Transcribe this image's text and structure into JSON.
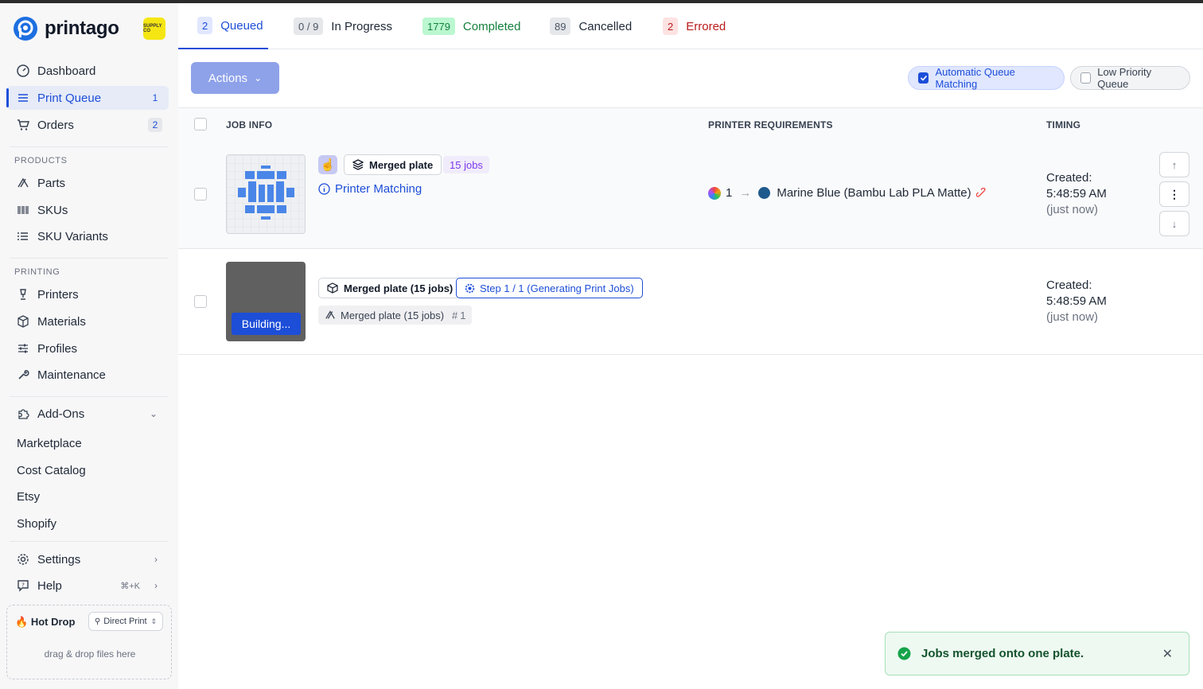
{
  "brand": {
    "name": "printago",
    "badge_text": "SUPPLY CO"
  },
  "nav": {
    "dashboard": "Dashboard",
    "print_queue": "Print Queue",
    "print_queue_count": "1",
    "orders": "Orders",
    "orders_count": "2",
    "products_label": "PRODUCTS",
    "parts": "Parts",
    "skus": "SKUs",
    "sku_variants": "SKU Variants",
    "printing_label": "PRINTING",
    "printers": "Printers",
    "materials": "Materials",
    "profiles": "Profiles",
    "maintenance": "Maintenance",
    "addons": "Add-Ons",
    "marketplace": "Marketplace",
    "cost_catalog": "Cost Catalog",
    "etsy": "Etsy",
    "shopify": "Shopify",
    "settings": "Settings",
    "help": "Help",
    "help_shortcut": "⌘+K"
  },
  "hotdrop": {
    "title": "Hot Drop",
    "select_value": "Direct Print",
    "hint": "drag & drop files here"
  },
  "tabs": [
    {
      "count": "2",
      "label": "Queued"
    },
    {
      "count": "0 / 9",
      "label": "In Progress"
    },
    {
      "count": "1779",
      "label": "Completed"
    },
    {
      "count": "89",
      "label": "Cancelled"
    },
    {
      "count": "2",
      "label": "Errored"
    }
  ],
  "toolbar": {
    "actions_label": "Actions",
    "auto_match_label": "Automatic Queue Matching",
    "auto_match_checked": true,
    "low_priority_label": "Low Priority Queue",
    "low_priority_checked": false
  },
  "table": {
    "col_job_info": "JOB INFO",
    "col_printer_requirements": "PRINTER REQUIREMENTS",
    "col_timing": "TIMING"
  },
  "rows": [
    {
      "chip": "Merged plate",
      "jobs_badge": "15 jobs",
      "link": "Printer Matching",
      "req_slot": "1",
      "req_material": "Marine Blue (Bambu Lab PLA Matte)",
      "material_color": "#1f5a8c",
      "created_label": "Created:",
      "created_time": "5:48:59 AM",
      "created_rel": "(just now)"
    },
    {
      "chip": "Merged plate (15 jobs)",
      "step": "Step 1 / 1 (Generating Print Jobs)",
      "sub_chip": "Merged plate (15 jobs)",
      "sub_index": "1",
      "status": "Building...",
      "created_label": "Created:",
      "created_time": "5:48:59 AM",
      "created_rel": "(just now)"
    }
  ],
  "toast": {
    "message": "Jobs merged onto one plate."
  },
  "colors": {
    "accent": "#1d4ed8",
    "success": "#16a34a",
    "error": "#dc2626"
  }
}
